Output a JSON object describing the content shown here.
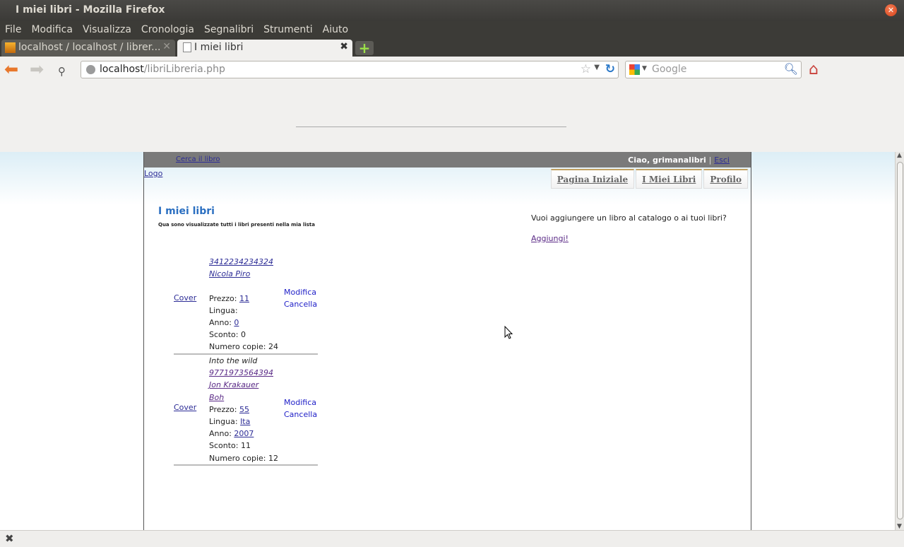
{
  "window": {
    "title": "I miei libri - Mozilla Firefox"
  },
  "menu": {
    "items": [
      "File",
      "Modifica",
      "Visualizza",
      "Cronologia",
      "Segnalibri",
      "Strumenti",
      "Aiuto"
    ]
  },
  "tabs": [
    {
      "label": "localhost / localhost / librer..."
    },
    {
      "label": "I miei libri"
    }
  ],
  "navbar": {
    "url_host": "localhost",
    "url_path": "/libriLibreria.php",
    "search_placeholder": "Google"
  },
  "page": {
    "top_search_link": "Cerca il libro",
    "greeting": "Ciao, grimanalibri",
    "separator": "|",
    "logout": "Esci",
    "logo": "Logo",
    "nav_tabs": [
      "Pagina Iniziale",
      "I Miei Libri",
      "Profilo"
    ],
    "title": "I miei libri",
    "subtitle": "Qua sono visualizzate tutti i libri presenti nella mia lista",
    "right_text": "Vuoi aggiungere un libro al catalogo o ai tuoi libri?",
    "right_link": "Aggiungi!",
    "books": [
      {
        "cover": "Cover",
        "title": "",
        "isbn": "3412234234324",
        "author": "Nicola Piro",
        "publisher": "",
        "price_label": "Prezzo:",
        "price": "11",
        "language_label": "Lingua:",
        "language": "",
        "year_label": "Anno:",
        "year": "0",
        "discount": "Sconto: 0",
        "copies": "Numero copie: 24",
        "edit": "Modifica",
        "delete": "Cancella"
      },
      {
        "cover": "Cover",
        "title": "Into the wild",
        "isbn": "9771973564394",
        "author": "Jon Krakauer",
        "publisher": "Boh",
        "price_label": "Prezzo:",
        "price": "55",
        "language_label": "Lingua:",
        "language": "Ita",
        "year_label": "Anno:",
        "year": "2007",
        "discount": "Sconto: 11",
        "copies": "Numero copie: 12",
        "edit": "Modifica",
        "delete": "Cancella"
      }
    ]
  }
}
